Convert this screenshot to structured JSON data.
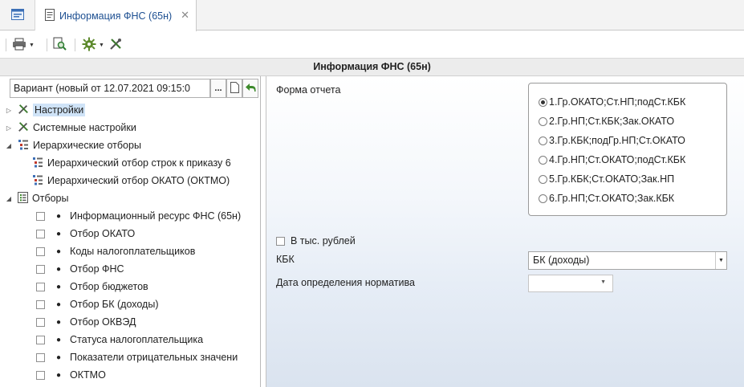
{
  "tabs": {
    "home_icon": "window-icon",
    "active_label": "Информация ФНС (65н)",
    "close": "✕"
  },
  "toolbar": {
    "icons": [
      "print-icon",
      "chevron-down-icon",
      "preview-icon",
      "settings-gear-icon",
      "chevron-down-icon",
      "tools-icon"
    ]
  },
  "header": {
    "title": "Информация ФНС (65н)"
  },
  "variant": {
    "value": "Вариант (новый от 12.07.2021 09:15:0",
    "more": "..."
  },
  "tree": {
    "nodes": [
      {
        "label": "Настройки",
        "icon": "tools-icon",
        "expander": "▷",
        "selected": true
      },
      {
        "label": "Системные настройки",
        "icon": "tools-icon",
        "expander": "▷"
      },
      {
        "label": "Иерархические отборы",
        "icon": "hierarchy-icon",
        "expander": "◢"
      },
      {
        "label": "Иерархический отбор строк к приказу 6",
        "icon": "hierarchy-icon"
      },
      {
        "label": "Иерархический отбор ОКАТО (ОКТМО)",
        "icon": "hierarchy-icon"
      },
      {
        "label": "Отборы",
        "icon": "filter-list-icon",
        "expander": "◢"
      }
    ],
    "filters": [
      "Информационный ресурс ФНС (65н)",
      "Отбор ОКАТО",
      "Коды налогоплательщиков",
      "Отбор ФНС",
      "Отбор бюджетов",
      "Отбор БК (доходы)",
      "Отбор ОКВЭД",
      "Статуса налогоплательщика",
      "Показатели отрицательных значени",
      "ОКТМО"
    ]
  },
  "form": {
    "report_form_label": "Форма отчета",
    "options": [
      "1.Гр.ОКАТО;Ст.НП;подСт.КБК",
      "2.Гр.НП;Ст.КБК;Зак.ОКАТО",
      "3.Гр.КБК;подГр.НП;Ст.ОКАТО",
      "4.Гр.НП;Ст.ОКАТО;подСт.КБК",
      "5.Гр.КБК;Ст.ОКАТО;Зак.НП",
      "6.Гр.НП;Ст.ОКАТО;Зак.КБК"
    ],
    "selected_option": "1.Гр.ОКАТО;Ст.НП;подСт.КБК",
    "thousands_label": "В тыс. рублей",
    "kbk_label": "КБК",
    "kbk_value": "БК (доходы)",
    "date_label": "Дата определения норматива",
    "date_value": ""
  }
}
